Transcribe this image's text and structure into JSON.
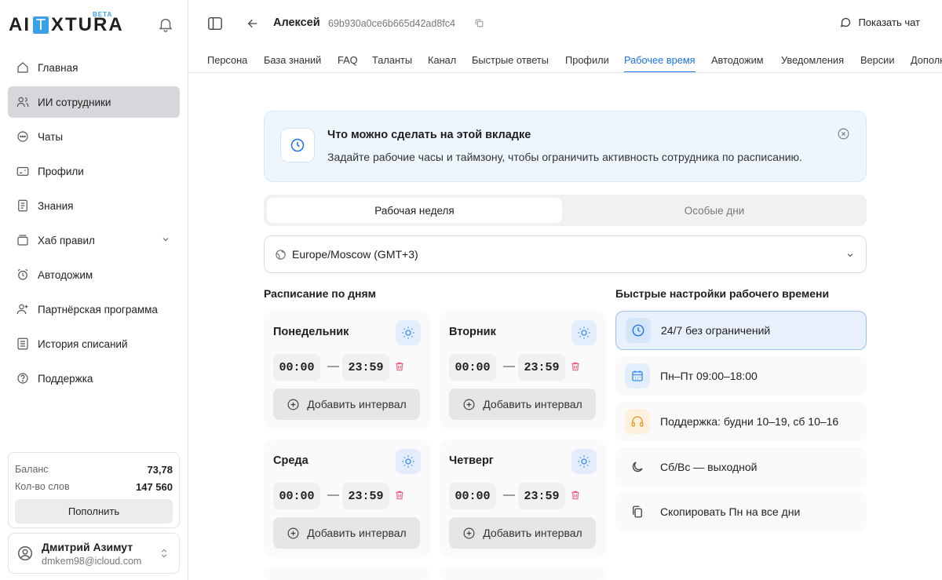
{
  "brand": {
    "logo_left": "AI",
    "logo_mid": "T",
    "logo_right": "XTURA",
    "badge": "BETA"
  },
  "sidebar": {
    "items": [
      {
        "label": "Главная"
      },
      {
        "label": "ИИ сотрудники"
      },
      {
        "label": "Чаты"
      },
      {
        "label": "Профили"
      },
      {
        "label": "Знания"
      },
      {
        "label": "Хаб правил"
      },
      {
        "label": "Автодожим"
      },
      {
        "label": "Партнёрская программа"
      },
      {
        "label": "История списаний"
      },
      {
        "label": "Поддержка"
      }
    ],
    "active_index": 1
  },
  "balance": {
    "balance_label": "Баланс",
    "balance_value": "73,78",
    "words_label": "Кол-во слов",
    "words_value": "147 560",
    "topup_label": "Пополнить"
  },
  "user": {
    "name": "Дмитрий Азимут",
    "email": "dmkem98@icloud.com"
  },
  "header": {
    "name": "Алексей",
    "id": "69b930a0ce6b665d42ad8fc4",
    "chat_label": "Показать чат"
  },
  "tabs": [
    "Персона",
    "База знаний",
    "FAQ",
    "Таланты",
    "Канал",
    "Быстрые ответы",
    "Профили",
    "Рабочее время",
    "Автодожим",
    "Уведомления",
    "Версии",
    "Дополн"
  ],
  "active_tab": "Рабочее время",
  "info": {
    "title": "Что можно сделать на этой вкладке",
    "text": "Задайте рабочие часы и таймзону, чтобы ограничить активность сотрудника по расписанию."
  },
  "segment": {
    "week": "Рабочая неделя",
    "special": "Особые дни",
    "selected": "Рабочая неделя"
  },
  "timezone": "Europe/Moscow (GMT+3)",
  "schedule": {
    "title": "Расписание по дням",
    "add_label": "Добавить интервал",
    "days": [
      {
        "name": "Понедельник",
        "from": "00:00",
        "to": "23:59"
      },
      {
        "name": "Вторник",
        "from": "00:00",
        "to": "23:59"
      },
      {
        "name": "Среда",
        "from": "00:00",
        "to": "23:59"
      },
      {
        "name": "Четверг",
        "from": "00:00",
        "to": "23:59"
      }
    ]
  },
  "quick": {
    "title": "Быстрые настройки рабочего времени",
    "items": [
      {
        "label": "24/7 без ограничений",
        "icon": "clock-icon"
      },
      {
        "label": "Пн–Пт 09:00–18:00",
        "icon": "calendar-icon"
      },
      {
        "label": "Поддержка: будни 10–19, сб 10–16",
        "icon": "headphones-icon"
      },
      {
        "label": "Сб/Вс — выходной",
        "icon": "moon-icon"
      },
      {
        "label": "Скопировать Пн на все дни",
        "icon": "copy-icon"
      }
    ],
    "selected": "24/7 без ограничений"
  },
  "colors": {
    "accent": "#1a73e8",
    "info_bg": "#eef6fd",
    "active_nav": "#d8d6db",
    "trash": "#e8637f"
  }
}
